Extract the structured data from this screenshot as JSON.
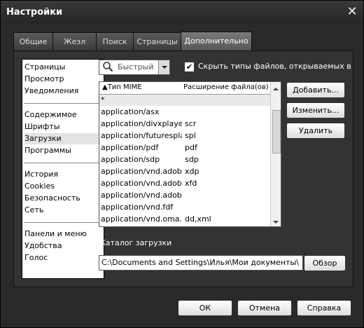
{
  "window": {
    "title": "Настройки"
  },
  "tabs": [
    {
      "label": "Общие"
    },
    {
      "label": "Жезл"
    },
    {
      "label": "Поиск"
    },
    {
      "label": "Страницы"
    },
    {
      "label": "Дополнительно",
      "active": true
    }
  ],
  "sidebar": {
    "items": [
      {
        "label": "Страницы"
      },
      {
        "label": "Просмотр"
      },
      {
        "label": "Уведомления"
      },
      {
        "label": "Содержимое"
      },
      {
        "label": "Шрифты"
      },
      {
        "label": "Загрузки",
        "selected": true
      },
      {
        "label": "Программы"
      },
      {
        "label": "История"
      },
      {
        "label": "Cookies"
      },
      {
        "label": "Безопасность"
      },
      {
        "label": "Сеть"
      },
      {
        "label": "Панели и меню"
      },
      {
        "label": "Удобства"
      },
      {
        "label": "Голос"
      }
    ]
  },
  "quick_find": {
    "placeholder": "Быстрый п"
  },
  "hide_types": {
    "checked": true,
    "label": "Скрыть типы файлов, открываемых в Op"
  },
  "mime_table": {
    "columns": [
      "Тип MIME",
      "Расширение файла(ов)"
    ],
    "rows": [
      [
        "*",
        ""
      ],
      [
        "application/asx",
        ""
      ],
      [
        "application/divxplayer...",
        "scr"
      ],
      [
        "application/futuresplash",
        "spl"
      ],
      [
        "application/pdf",
        "pdf"
      ],
      [
        "application/sdp",
        "sdp"
      ],
      [
        "application/vnd.adobe....",
        "xdp"
      ],
      [
        "application/vnd.adobe....",
        "xfd"
      ],
      [
        "application/vnd.adobe....",
        ""
      ],
      [
        "application/vnd.fdf",
        ""
      ],
      [
        "application/vnd.oma.d...",
        "dd,xml"
      ]
    ]
  },
  "buttons": {
    "add": "Добавить...",
    "edit": "Изменить...",
    "delete": "Удалить",
    "browse": "Обзор"
  },
  "download_dir": {
    "label": "Каталог загрузки",
    "value": "C:\\Documents and Settings\\Илья\\Мои документы\\"
  },
  "footer": {
    "ok": "ОК",
    "cancel": "Отмена",
    "help": "Справка"
  }
}
